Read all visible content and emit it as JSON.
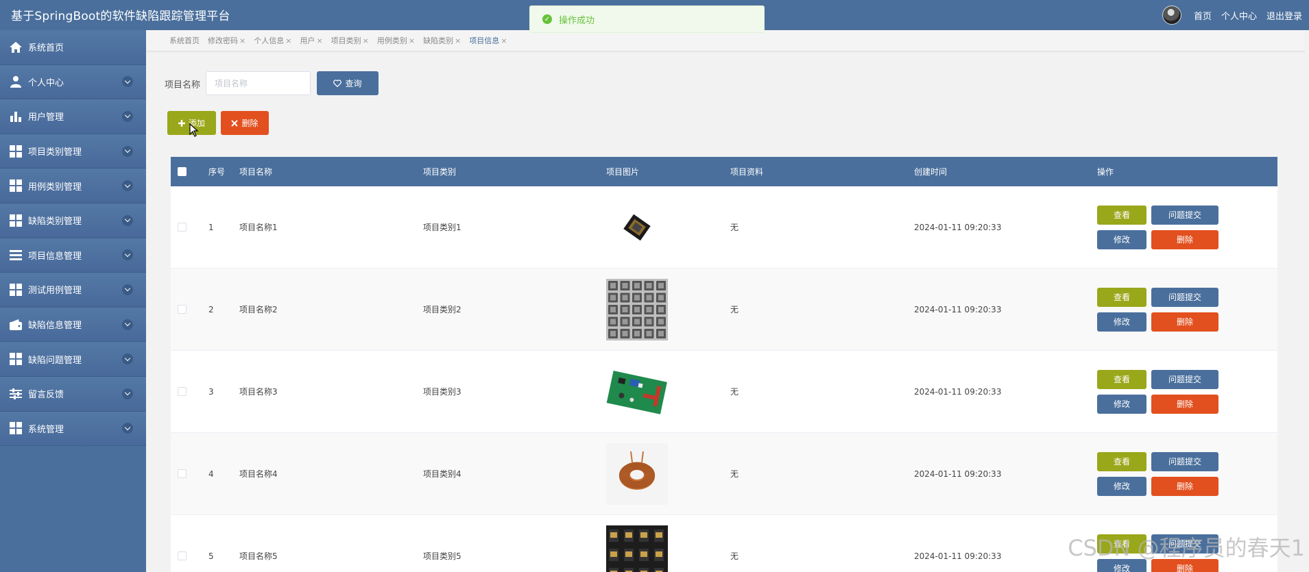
{
  "app": {
    "title": "基于SpringBoot的软件缺陷跟踪管理平台",
    "nav": {
      "home": "首页",
      "profile": "个人中心",
      "logout": "退出登录"
    }
  },
  "toast": {
    "message": "操作成功",
    "color": "#67c23a"
  },
  "theme": {
    "primary": "#4a6f9c",
    "olive": "#99a71a",
    "danger": "#e2501f"
  },
  "sidebar": {
    "items": [
      {
        "label": "系统首页",
        "icon": "home-icon",
        "expandable": false
      },
      {
        "label": "个人中心",
        "icon": "user-icon",
        "expandable": true
      },
      {
        "label": "用户管理",
        "icon": "bar-chart-icon",
        "expandable": true
      },
      {
        "label": "项目类别管理",
        "icon": "grid-icon",
        "expandable": true
      },
      {
        "label": "用例类别管理",
        "icon": "grid-icon",
        "expandable": true
      },
      {
        "label": "缺陷类别管理",
        "icon": "grid-icon",
        "expandable": true
      },
      {
        "label": "项目信息管理",
        "icon": "list-icon",
        "expandable": true
      },
      {
        "label": "测试用例管理",
        "icon": "grid-icon",
        "expandable": true
      },
      {
        "label": "缺陷信息管理",
        "icon": "wallet-icon",
        "expandable": true
      },
      {
        "label": "缺陷问题管理",
        "icon": "grid-icon",
        "expandable": true
      },
      {
        "label": "留言反馈",
        "icon": "sliders-icon",
        "expandable": true
      },
      {
        "label": "系统管理",
        "icon": "grid-icon",
        "expandable": true
      }
    ]
  },
  "tabs": [
    {
      "label": "系统首页",
      "closable": false
    },
    {
      "label": "修改密码",
      "closable": true
    },
    {
      "label": "个人信息",
      "closable": true
    },
    {
      "label": "用户",
      "closable": true
    },
    {
      "label": "项目类别",
      "closable": true
    },
    {
      "label": "用例类别",
      "closable": true
    },
    {
      "label": "缺陷类别",
      "closable": true
    },
    {
      "label": "项目信息",
      "closable": true,
      "active": true
    }
  ],
  "search": {
    "label": "项目名称",
    "placeholder": "项目名称",
    "query_label": "查询"
  },
  "actions": {
    "add_label": "添加",
    "delete_label": "删除"
  },
  "table": {
    "columns": [
      "序号",
      "项目名称",
      "项目类别",
      "项目图片",
      "项目资料",
      "创建时间",
      "操作"
    ],
    "rows": [
      {
        "no": "1",
        "name": "项目名称1",
        "type": "项目类别1",
        "image": "chip-image",
        "doc": "无",
        "time": "2024-01-11 09:20:33"
      },
      {
        "no": "2",
        "name": "项目名称2",
        "type": "项目类别2",
        "image": "tray-image",
        "doc": "无",
        "time": "2024-01-11 09:20:33"
      },
      {
        "no": "3",
        "name": "项目名称3",
        "type": "项目类别3",
        "image": "pcb-image",
        "doc": "无",
        "time": "2024-01-11 09:20:33"
      },
      {
        "no": "4",
        "name": "项目名称4",
        "type": "项目类别4",
        "image": "coil-image",
        "doc": "无",
        "time": "2024-01-11 09:20:33"
      },
      {
        "no": "5",
        "name": "项目名称5",
        "type": "项目类别5",
        "image": "components-image",
        "doc": "无",
        "time": "2024-01-11 09:20:33"
      }
    ],
    "row_actions": {
      "view": "查看",
      "issue": "问题提交",
      "edit": "修改",
      "delete": "删除"
    }
  },
  "watermark": "CSDN @程序员的春天1"
}
